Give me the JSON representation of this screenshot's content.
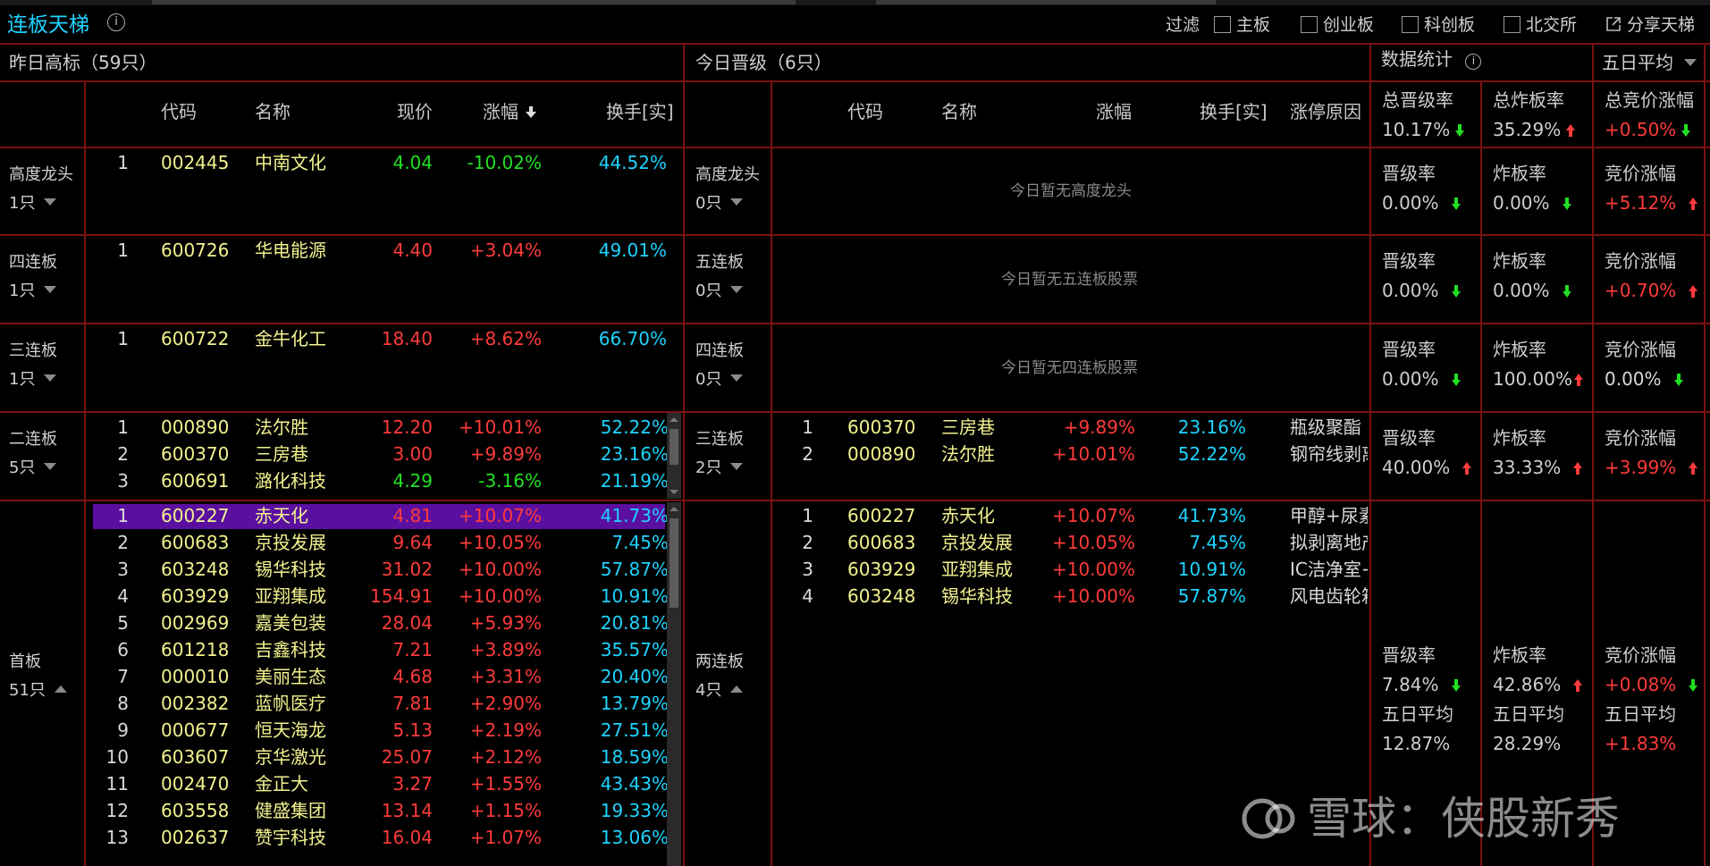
{
  "app": {
    "title": "连板天梯",
    "info_icon": "info-icon"
  },
  "filter": {
    "label": "过滤",
    "options": [
      "主板",
      "创业板",
      "科创板",
      "北交所"
    ],
    "share": "分享天梯"
  },
  "left_panel": {
    "title": "昨日高标（59只）",
    "columns": [
      "代码",
      "名称",
      "现价",
      "涨幅",
      "换手[实]"
    ]
  },
  "right_panel": {
    "title": "今日晋级（6只）",
    "columns": [
      "代码",
      "名称",
      "涨幅",
      "换手[实]",
      "涨停原因"
    ]
  },
  "stats": {
    "title": "数据统计",
    "period": "五日平均",
    "total": {
      "promo_label": "总晋级率",
      "promo": "10.17%",
      "bomb_label": "总炸板率",
      "bomb": "35.29%",
      "bid_label": "总竞价涨幅",
      "bid": "+0.50%"
    }
  },
  "tiers": [
    {
      "left_label": "高度龙头",
      "left_count": "1只",
      "right_label": "高度龙头",
      "right_count": "0只",
      "empty_text": "今日暂无高度龙头",
      "promo_label": "晋级率",
      "promo": "0.00%",
      "bomb_label": "炸板率",
      "bomb": "0.00%",
      "bid_label": "竞价涨幅",
      "bid": "+5.12%"
    },
    {
      "left_label": "四连板",
      "left_count": "1只",
      "right_label": "五连板",
      "right_count": "0只",
      "empty_text": "今日暂无五连板股票",
      "promo_label": "晋级率",
      "promo": "0.00%",
      "bomb_label": "炸板率",
      "bomb": "0.00%",
      "bid_label": "竞价涨幅",
      "bid": "+0.70%"
    },
    {
      "left_label": "三连板",
      "left_count": "1只",
      "right_label": "四连板",
      "right_count": "0只",
      "empty_text": "今日暂无四连板股票",
      "promo_label": "晋级率",
      "promo": "0.00%",
      "bomb_label": "炸板率",
      "bomb": "100.00%",
      "bid_label": "竞价涨幅",
      "bid": "0.00%"
    },
    {
      "left_label": "二连板",
      "left_count": "5只",
      "right_label": "三连板",
      "right_count": "2只",
      "empty_text": "",
      "promo_label": "晋级率",
      "promo": "40.00%",
      "bomb_label": "炸板率",
      "bomb": "33.33%",
      "bid_label": "竞价涨幅",
      "bid": "+3.99%"
    },
    {
      "left_label": "首板",
      "left_count": "51只",
      "right_label": "两连板",
      "right_count": "4只",
      "empty_text": "",
      "promo_label": "晋级率",
      "promo": "7.84%",
      "bomb_label": "炸板率",
      "bomb": "42.86%",
      "bid_label": "竞价涨幅",
      "bid": "+0.08%",
      "avg_label": "五日平均",
      "avg_promo": "12.87%",
      "avg_bomb": "28.29%",
      "avg_bid": "+1.83%"
    }
  ],
  "left_rows": {
    "t0": [
      [
        "1",
        "002445",
        "中南文化",
        "4.04",
        "-10.02%",
        "44.52%"
      ]
    ],
    "t1": [
      [
        "1",
        "600726",
        "华电能源",
        "4.40",
        "+3.04%",
        "49.01%"
      ]
    ],
    "t2": [
      [
        "1",
        "600722",
        "金牛化工",
        "18.40",
        "+8.62%",
        "66.70%"
      ]
    ],
    "t3": [
      [
        "1",
        "000890",
        "法尔胜",
        "12.20",
        "+10.01%",
        "52.22%"
      ],
      [
        "2",
        "600370",
        "三房巷",
        "3.00",
        "+9.89%",
        "23.16%"
      ],
      [
        "3",
        "600691",
        "潞化科技",
        "4.29",
        "-3.16%",
        "21.19%"
      ]
    ],
    "t4": [
      [
        "1",
        "600227",
        "赤天化",
        "4.81",
        "+10.07%",
        "41.73%"
      ],
      [
        "2",
        "600683",
        "京投发展",
        "9.64",
        "+10.05%",
        "7.45%"
      ],
      [
        "3",
        "603248",
        "锡华科技",
        "31.02",
        "+10.00%",
        "57.87%"
      ],
      [
        "4",
        "603929",
        "亚翔集成",
        "154.91",
        "+10.00%",
        "10.91%"
      ],
      [
        "5",
        "002969",
        "嘉美包装",
        "28.04",
        "+5.93%",
        "20.81%"
      ],
      [
        "6",
        "601218",
        "吉鑫科技",
        "7.21",
        "+3.89%",
        "35.57%"
      ],
      [
        "7",
        "000010",
        "美丽生态",
        "4.68",
        "+3.31%",
        "20.40%"
      ],
      [
        "8",
        "002382",
        "蓝帆医疗",
        "7.81",
        "+2.90%",
        "13.79%"
      ],
      [
        "9",
        "000677",
        "恒天海龙",
        "5.13",
        "+2.19%",
        "27.51%"
      ],
      [
        "10",
        "603607",
        "京华激光",
        "25.07",
        "+2.12%",
        "18.59%"
      ],
      [
        "11",
        "002470",
        "金正大",
        "3.27",
        "+1.55%",
        "43.43%"
      ],
      [
        "12",
        "603558",
        "健盛集团",
        "13.14",
        "+1.15%",
        "19.33%"
      ],
      [
        "13",
        "002637",
        "赞宇科技",
        "16.04",
        "+1.07%",
        "13.06%"
      ]
    ]
  },
  "right_rows": {
    "t3": [
      [
        "1",
        "600370",
        "三房巷",
        "+9.89%",
        "23.16%",
        "瓶级聚酯"
      ],
      [
        "2",
        "000890",
        "法尔胜",
        "+10.01%",
        "52.22%",
        "钢帘线剥离"
      ]
    ],
    "t4": [
      [
        "1",
        "600227",
        "赤天化",
        "+10.07%",
        "41.73%",
        "甲醇+尿素"
      ],
      [
        "2",
        "600683",
        "京投发展",
        "+10.05%",
        "7.45%",
        "拟剥离地产"
      ],
      [
        "3",
        "603929",
        "亚翔集成",
        "+10.00%",
        "10.91%",
        "IC洁净室+"
      ],
      [
        "4",
        "603248",
        "锡华科技",
        "+10.00%",
        "57.87%",
        "风电齿轮箱"
      ]
    ]
  },
  "watermark": "雪球：侠股新秀",
  "colors": {
    "border": "#7a1111",
    "up": "#ff3b3b",
    "down": "#22e022",
    "turnover": "#1fd3ff",
    "code_name": "#f2f28f",
    "selected": "#5a0fa0",
    "title": "#1fd3ff"
  }
}
